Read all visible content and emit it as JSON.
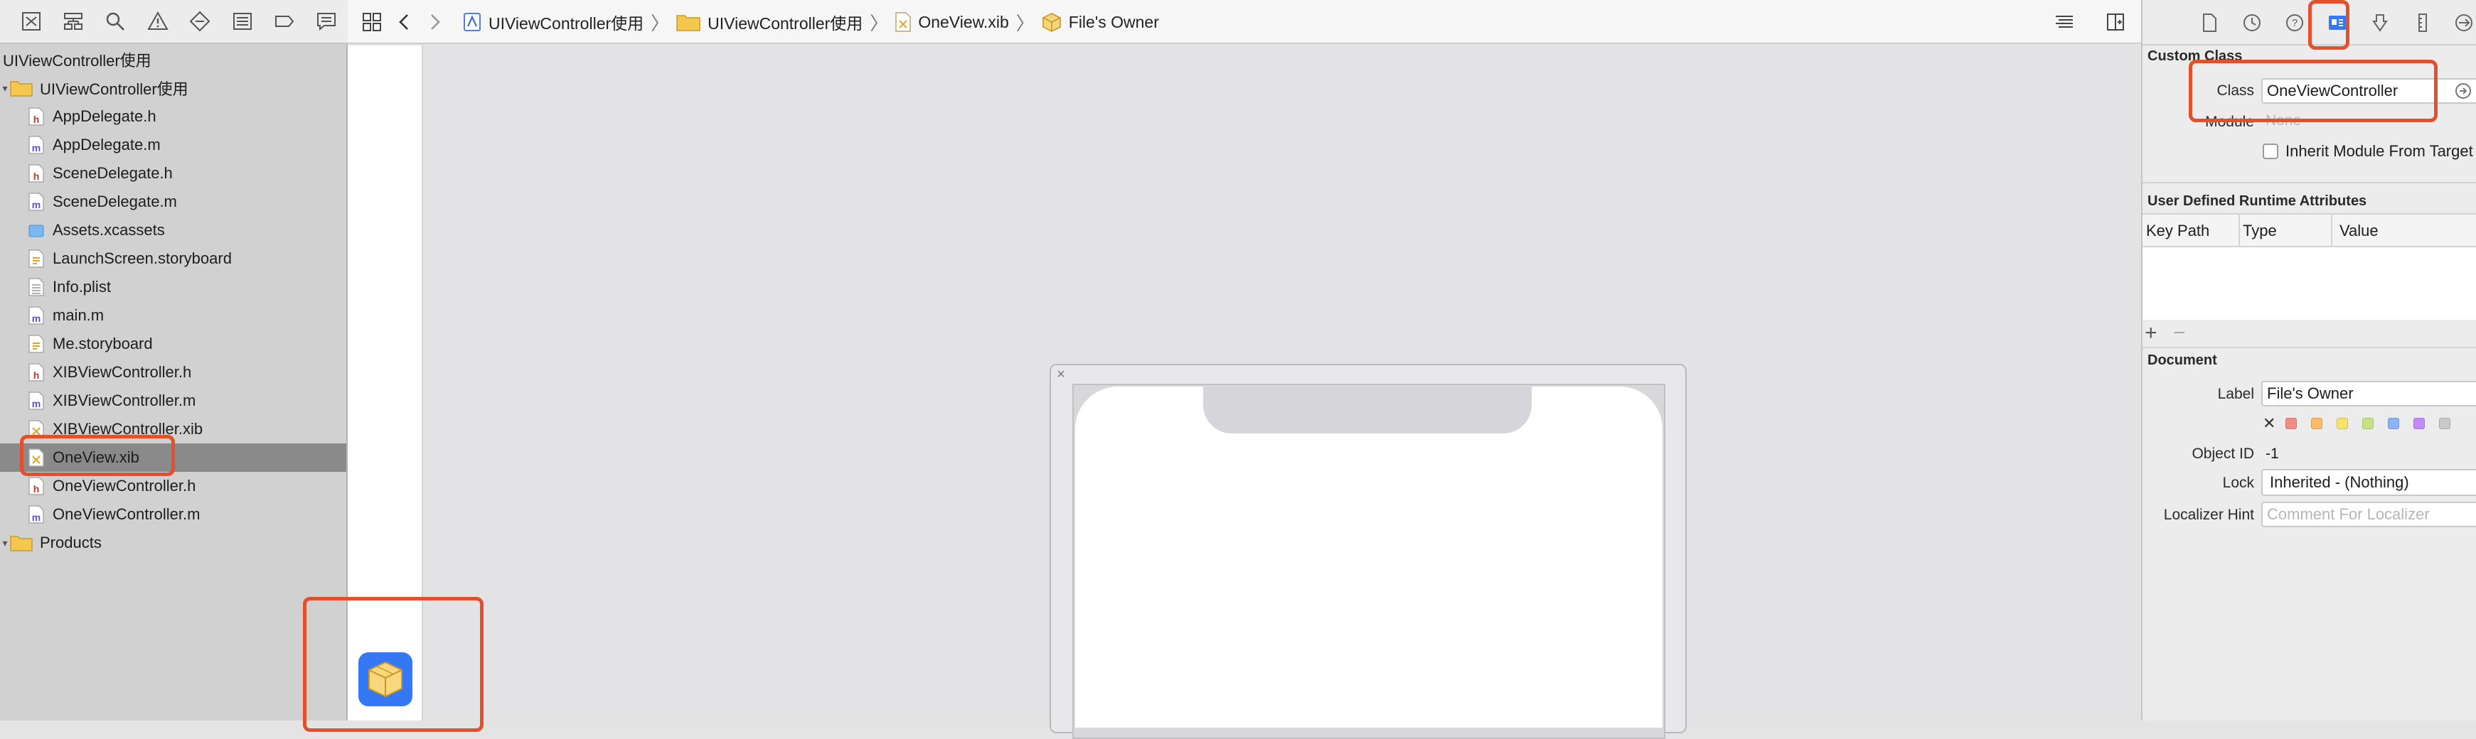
{
  "navigator": {
    "toolbar_icons": [
      "project-navigator-icon",
      "source-control-icon",
      "find-icon",
      "issue-icon",
      "test-icon",
      "debug-icon",
      "breakpoint-icon",
      "report-icon"
    ],
    "tree": [
      {
        "label": "UIViewController使用",
        "kind": "project",
        "indent": 0
      },
      {
        "label": "UIViewController使用",
        "kind": "folder",
        "indent": 1
      },
      {
        "label": "AppDelegate.h",
        "kind": "h",
        "indent": 2
      },
      {
        "label": "AppDelegate.m",
        "kind": "m",
        "indent": 2
      },
      {
        "label": "SceneDelegate.h",
        "kind": "h",
        "indent": 2
      },
      {
        "label": "SceneDelegate.m",
        "kind": "m",
        "indent": 2
      },
      {
        "label": "Assets.xcassets",
        "kind": "assets",
        "indent": 2
      },
      {
        "label": "LaunchScreen.storyboard",
        "kind": "storyboard",
        "indent": 2
      },
      {
        "label": "Info.plist",
        "kind": "plist",
        "indent": 2
      },
      {
        "label": "main.m",
        "kind": "m",
        "indent": 2
      },
      {
        "label": "Me.storyboard",
        "kind": "storyboard",
        "indent": 2
      },
      {
        "label": "XIBViewController.h",
        "kind": "h",
        "indent": 2
      },
      {
        "label": "XIBViewController.m",
        "kind": "m",
        "indent": 2
      },
      {
        "label": "XIBViewController.xib",
        "kind": "xib",
        "indent": 2
      },
      {
        "label": "OneView.xib",
        "kind": "xib",
        "indent": 2,
        "selected": true
      },
      {
        "label": "OneViewController.h",
        "kind": "h",
        "indent": 2
      },
      {
        "label": "OneViewController.m",
        "kind": "m",
        "indent": 2
      },
      {
        "label": "Products",
        "kind": "folder",
        "indent": 1
      }
    ]
  },
  "jumpbar": {
    "crumbs": [
      "UIViewController使用",
      "UIViewController使用",
      "OneView.xib",
      "File's Owner"
    ]
  },
  "inspector": {
    "custom_class_title": "Custom Class",
    "class_label": "Class",
    "class_value": "OneViewController",
    "module_label": "Module",
    "module_placeholder": "None",
    "inherit_label": "Inherit Module From Target",
    "udra_title": "User Defined Runtime Attributes",
    "col_key_path": "Key Path",
    "col_type": "Type",
    "col_value": "Value",
    "add_glyph": "+",
    "remove_glyph": "−",
    "document_title": "Document",
    "label_label": "Label",
    "label_value": "File's Owner",
    "object_id_label": "Object ID",
    "object_id_value": "-1",
    "lock_label": "Lock",
    "lock_value": "Inherited - (Nothing)",
    "localizer_label": "Localizer Hint",
    "localizer_placeholder": "Comment For Localizer",
    "swatch_colors": [
      "#f28b82",
      "#fbbc6a",
      "#f7e36b",
      "#c5e384",
      "#8ab4f8",
      "#c58af9",
      "#c9c9c9"
    ]
  },
  "colors": {
    "highlight": "#e2512b",
    "accent": "#3478f6"
  }
}
